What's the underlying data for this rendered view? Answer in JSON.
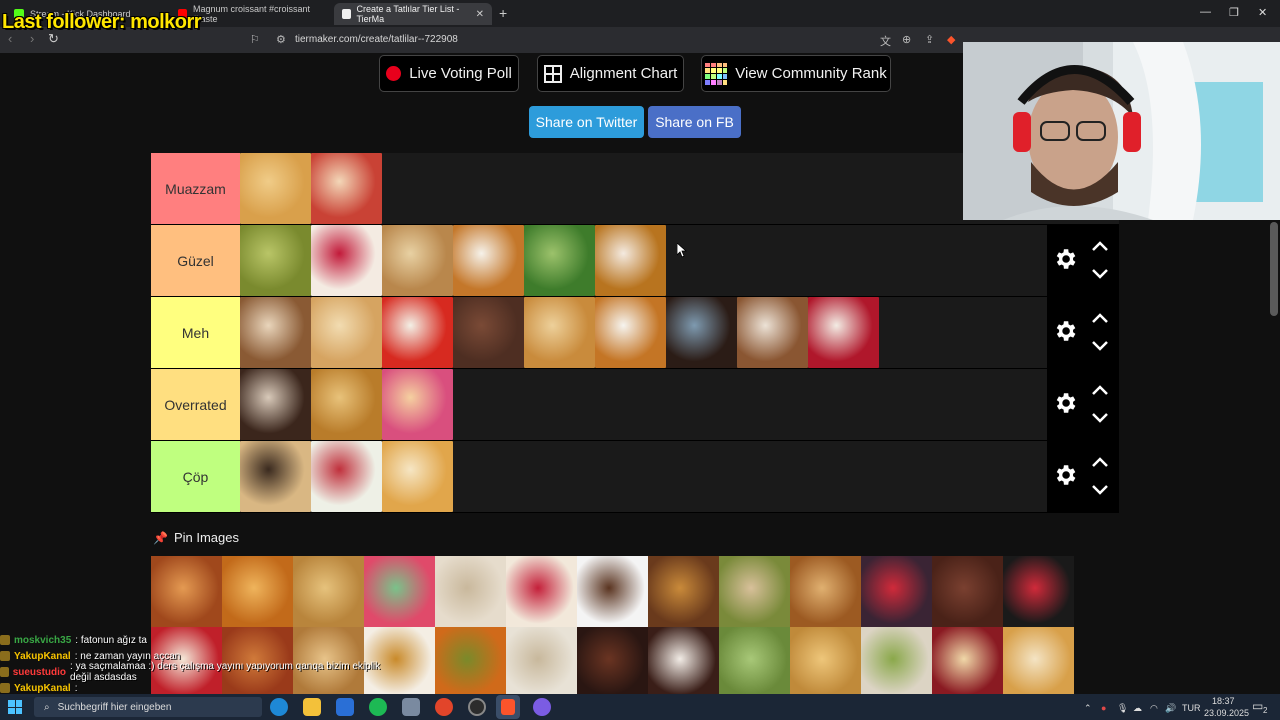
{
  "overlay": {
    "last_follower": "Last follower: molkorr"
  },
  "browser": {
    "tabs": [
      {
        "label": "Stream - Kick Dashboard"
      },
      {
        "label": "Magnum croissant #croissant #taste"
      },
      {
        "label": "Create a Tatlılar Tier List - TierMa"
      }
    ],
    "url": "tiermaker.com/create/tatlilar--722908"
  },
  "toolbar": {
    "live_voting": "Live Voting Poll",
    "alignment": "Alignment Chart",
    "community_rank": "View Community Rank",
    "share_twitter": "Share on Twitter",
    "share_fb": "Share on FB"
  },
  "tiers": [
    {
      "label": "Muazzam",
      "color": "#ff7f7f",
      "items": [
        "croissant",
        "turkish-dessert-red"
      ]
    },
    {
      "label": "Güzel",
      "color": "#ffbf7f",
      "items": [
        "baklava",
        "cheesecake",
        "kemalpasa",
        "lokma",
        "pistachio-cake",
        "kunefe"
      ]
    },
    {
      "label": "Meh",
      "color": "#ffff7f",
      "items": [
        "ekmek-kadayifi",
        "apple-pie",
        "red-dessert",
        "brownie",
        "sobiyet",
        "creme-brulee",
        "eclair",
        "leaf-cookies",
        "red-velvet"
      ]
    },
    {
      "label": "Overrated",
      "color": "#ffdf80",
      "items": [
        "chocolate-bun",
        "baklava-2",
        "donuts"
      ]
    },
    {
      "label": "Çöp",
      "color": "#bfff7f",
      "items": [
        "cannoli",
        "pismaniye",
        "cheesecake-2"
      ]
    }
  ],
  "pin": {
    "title": "Pin Images"
  },
  "chat": [
    {
      "user": "moskvich35",
      "msg": ": fatonun ağız ta",
      "color": "#39a845"
    },
    {
      "user": "YakupKanal",
      "msg": ": ne zaman yayın açcan",
      "color": "#f7c400"
    },
    {
      "user": "sueustudio",
      "msg": ": ya saçmalamaa :) ders çalışma yayını yapıyorum qanqa bizim ekiplik değil asdasdas",
      "color": "#ff3a3a"
    },
    {
      "user": "YakupKanal",
      "msg": ":",
      "color": "#f7c400"
    }
  ],
  "taskbar": {
    "search_placeholder": "Suchbegriff hier eingeben",
    "lang": "TUR",
    "time": "18:37",
    "date": "23.09.2025",
    "notif_count": "2"
  },
  "colors": {
    "share_twitter": "#2d9cdb",
    "share_fb": "#4a6fc7"
  }
}
